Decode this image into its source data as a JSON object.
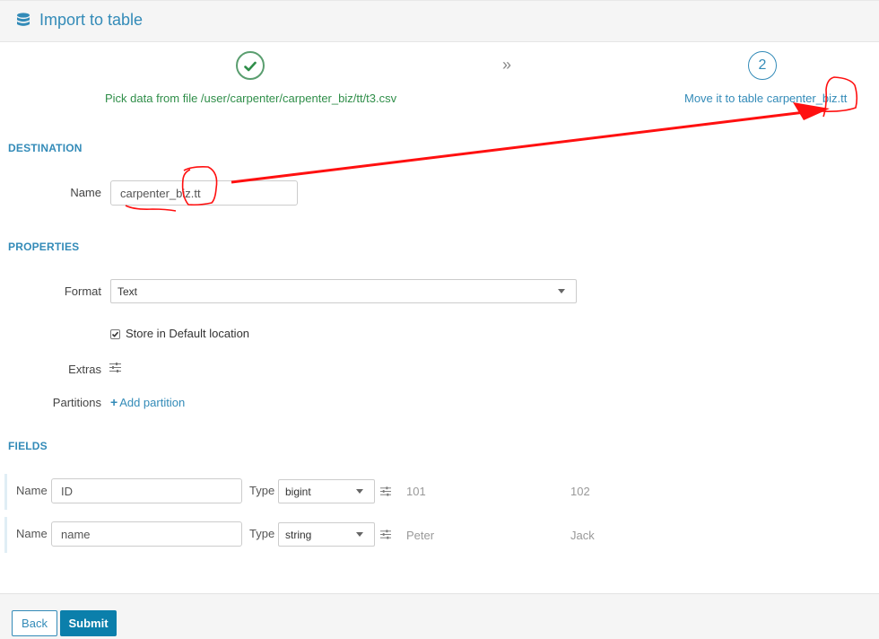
{
  "header": {
    "title": "Import to table",
    "icon": "database-icon"
  },
  "wizard": {
    "step1": {
      "label": "Pick data from file /user/carpenter/carpenter_biz/tt/t3.csv",
      "icon": "check-icon"
    },
    "separator": "»",
    "step2": {
      "number": "2",
      "label": "Move it to table carpenter_biz.tt"
    }
  },
  "destination": {
    "section_title": "DESTINATION",
    "name_label": "Name",
    "name_value": "carpenter_biz.tt"
  },
  "properties": {
    "section_title": "PROPERTIES",
    "format_label": "Format",
    "format_value": "Text",
    "store_default_label": "Store in Default location",
    "store_default_checked": true,
    "extras_label": "Extras",
    "partitions_label": "Partitions",
    "add_partition_label": "Add partition"
  },
  "fields": {
    "section_title": "FIELDS",
    "rows": [
      {
        "name_label": "Name",
        "name_value": "ID",
        "type_label": "Type",
        "type_value": "bigint",
        "sample1": "101",
        "sample2": "102"
      },
      {
        "name_label": "Name",
        "name_value": "name",
        "type_label": "Type",
        "type_value": "string",
        "sample1": "Peter",
        "sample2": "Jack"
      }
    ]
  },
  "footer": {
    "back_label": "Back",
    "submit_label": "Submit"
  },
  "colors": {
    "accent": "#338bb8",
    "success": "#2f8e49",
    "primary_button": "#0b7fab",
    "annotation": "#ff0000"
  }
}
